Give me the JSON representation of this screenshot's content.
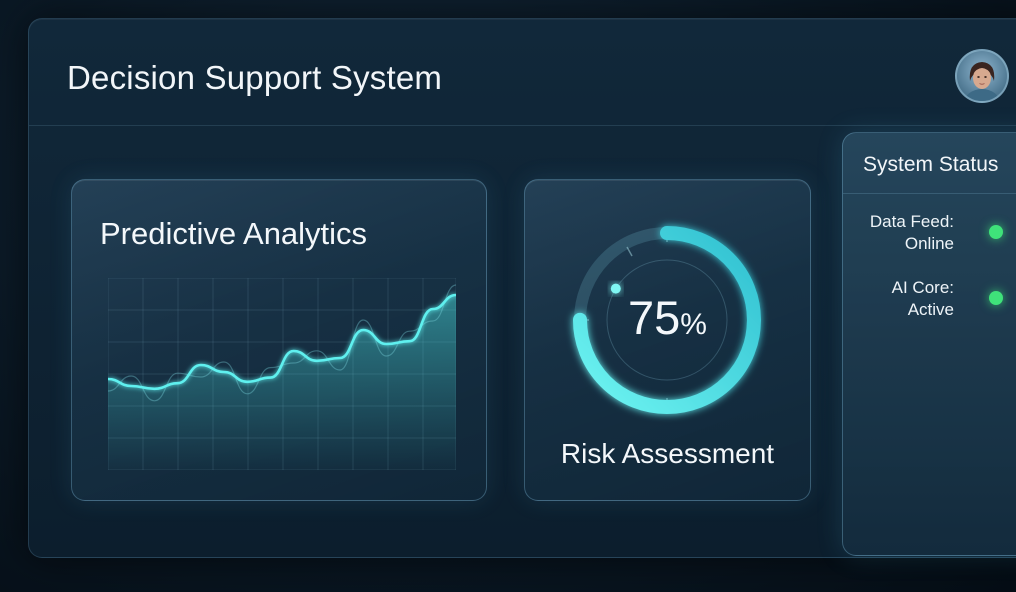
{
  "app": {
    "title": "Decision Support System",
    "accent_color": "#4de8e8",
    "status_ok_color": "#3fe27a"
  },
  "header": {
    "avatar_icon": "user-avatar"
  },
  "analytics": {
    "title": "Predictive Analytics",
    "trend": [
      0.35,
      0.3,
      0.28,
      0.32,
      0.45,
      0.4,
      0.33,
      0.36,
      0.55,
      0.48,
      0.5,
      0.7,
      0.6,
      0.62,
      0.85,
      0.95
    ]
  },
  "risk": {
    "value": "75",
    "unit": "%",
    "progress": 0.75,
    "label": "Risk Assessment"
  },
  "status": {
    "title": "System Status",
    "items": [
      {
        "label_line1": "Data Feed:",
        "label_line2": "Online",
        "state": "ok"
      },
      {
        "label_line1": "AI Core:",
        "label_line2": "Active",
        "state": "ok"
      }
    ]
  }
}
